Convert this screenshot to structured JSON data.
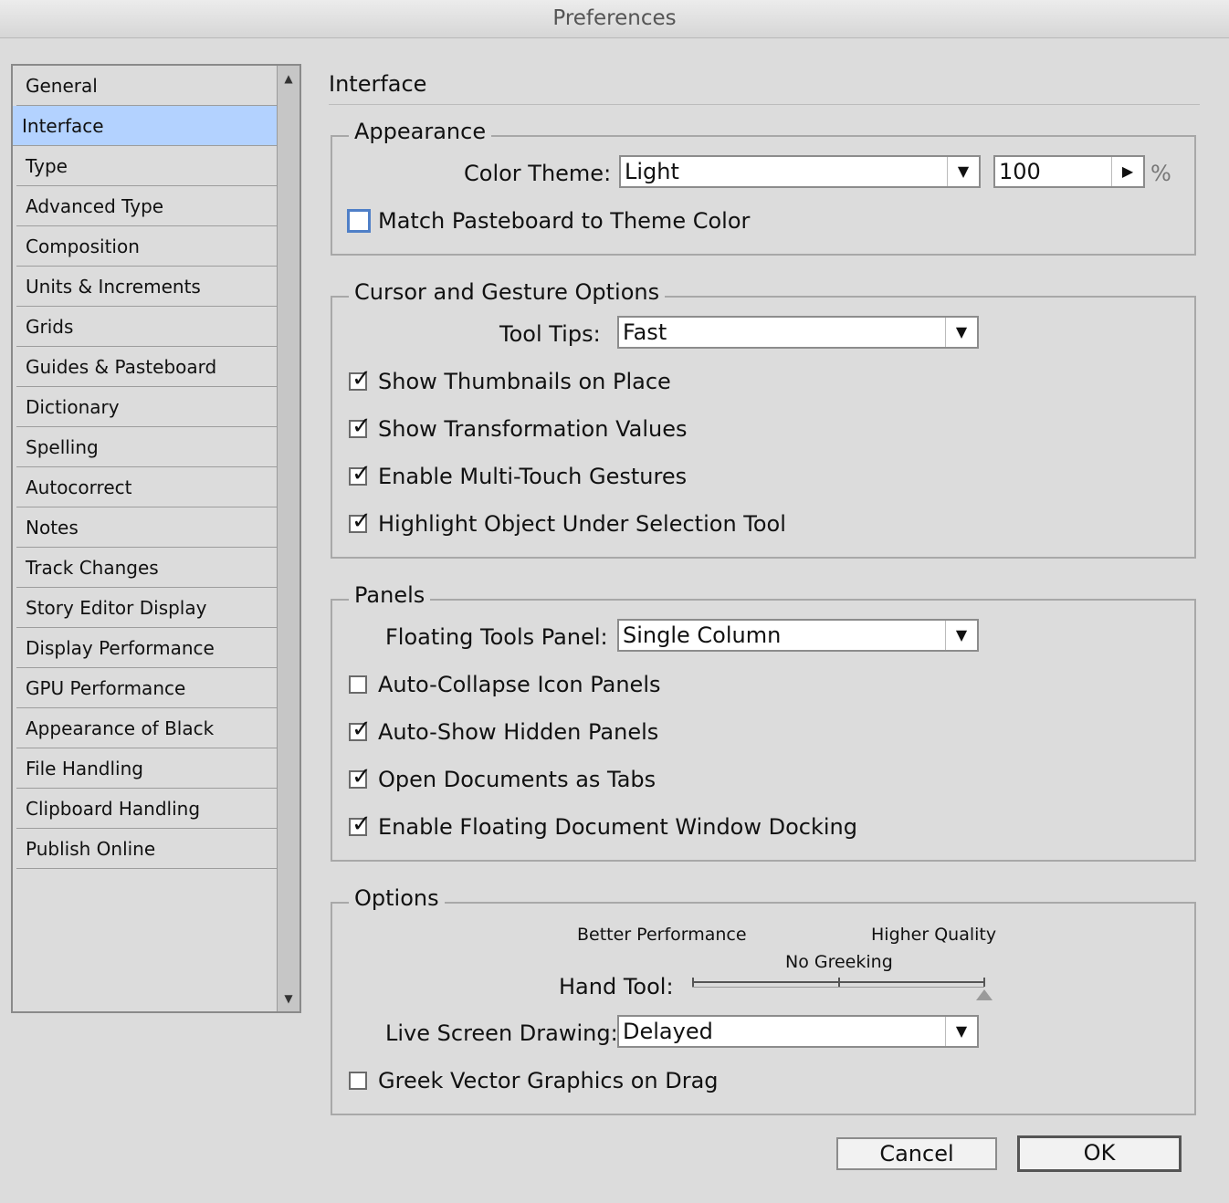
{
  "window": {
    "title": "Preferences"
  },
  "sidebar": {
    "items": [
      {
        "label": "General"
      },
      {
        "label": "Interface"
      },
      {
        "label": "Type"
      },
      {
        "label": "Advanced Type"
      },
      {
        "label": "Composition"
      },
      {
        "label": "Units & Increments"
      },
      {
        "label": "Grids"
      },
      {
        "label": "Guides & Pasteboard"
      },
      {
        "label": "Dictionary"
      },
      {
        "label": "Spelling"
      },
      {
        "label": "Autocorrect"
      },
      {
        "label": "Notes"
      },
      {
        "label": "Track Changes"
      },
      {
        "label": "Story Editor Display"
      },
      {
        "label": "Display Performance"
      },
      {
        "label": "GPU Performance"
      },
      {
        "label": "Appearance of Black"
      },
      {
        "label": "File Handling"
      },
      {
        "label": "Clipboard Handling"
      },
      {
        "label": "Publish Online"
      }
    ],
    "selected": "Interface"
  },
  "main": {
    "title": "Interface",
    "appearance": {
      "legend": "Appearance",
      "color_theme_label": "Color Theme:",
      "color_theme_value": "Light",
      "brightness_value": "100",
      "percent_sign": "%",
      "match_pasteboard_label": "Match Pasteboard to Theme Color",
      "match_pasteboard_checked": false
    },
    "cursor": {
      "legend": "Cursor and Gesture Options",
      "tool_tips_label": "Tool Tips:",
      "tool_tips_value": "Fast",
      "show_thumbnails_label": "Show Thumbnails on Place",
      "show_transformation_label": "Show Transformation Values",
      "enable_multitouch_label": "Enable Multi-Touch Gestures",
      "highlight_object_label": "Highlight Object Under Selection Tool"
    },
    "panels": {
      "legend": "Panels",
      "floating_tools_label": "Floating Tools Panel:",
      "floating_tools_value": "Single Column",
      "auto_collapse_label": "Auto-Collapse Icon Panels",
      "auto_show_label": "Auto-Show Hidden Panels",
      "open_docs_tabs_label": "Open Documents as Tabs",
      "enable_docking_label": "Enable Floating Document Window Docking"
    },
    "options": {
      "legend": "Options",
      "better_performance": "Better Performance",
      "higher_quality": "Higher Quality",
      "no_greeking": "No Greeking",
      "hand_tool_label": "Hand Tool:",
      "hand_tool_level": 1.0,
      "live_screen_label": "Live Screen Drawing:",
      "live_screen_value": "Delayed",
      "greek_vector_label": "Greek Vector Graphics on Drag"
    }
  },
  "buttons": {
    "cancel": "Cancel",
    "ok": "OK"
  },
  "colors": {
    "selection": "#b3d2ff",
    "background": "#dcdcdc",
    "focus": "#4f7fc7"
  },
  "icons": {
    "dropdown": "chevron-down-icon",
    "stepper": "triangle-right-icon",
    "check": "checkmark-icon"
  }
}
